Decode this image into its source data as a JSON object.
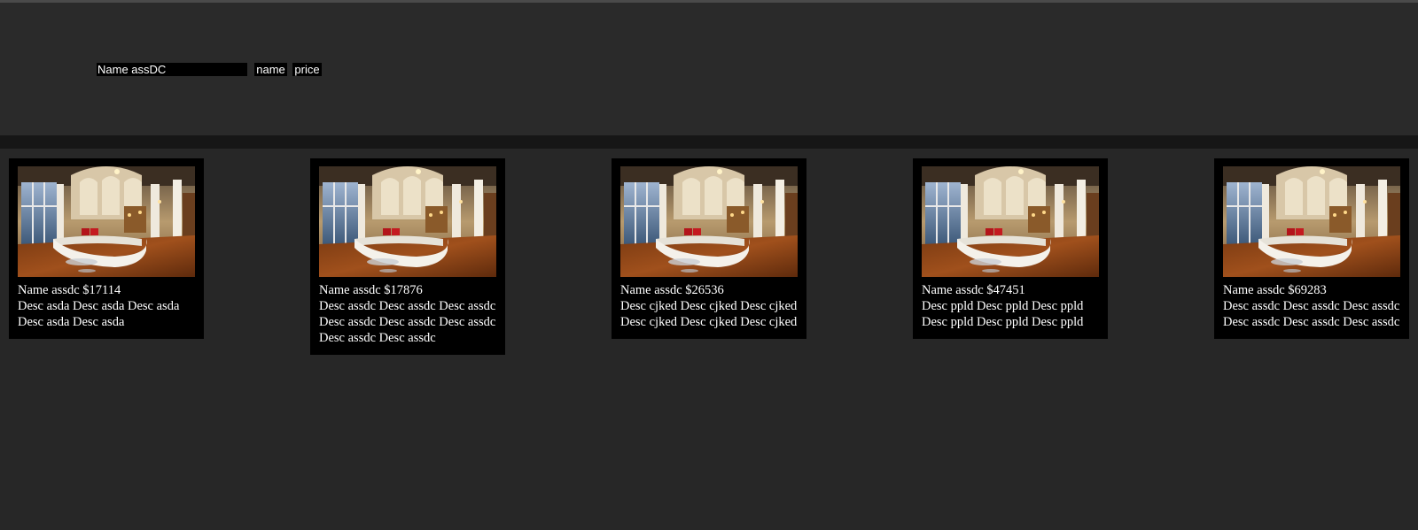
{
  "search": {
    "value": "Name assDC",
    "placeholder": ""
  },
  "sort": {
    "name_label": "name",
    "price_label": "price"
  },
  "products": [
    {
      "title": "Name assdc $17114",
      "desc": "Desc asda Desc asda Desc asda Desc asda Desc asda"
    },
    {
      "title": "Name assdc $17876",
      "desc": "Desc assdc Desc assdc Desc assdc Desc assdc Desc assdc Desc assdc Desc assdc Desc assdc"
    },
    {
      "title": "Name assdc $26536",
      "desc": "Desc cjked Desc cjked Desc cjked Desc cjked Desc cjked Desc cjked"
    },
    {
      "title": "Name assdc $47451",
      "desc": "Desc ppld Desc ppld Desc ppld Desc ppld Desc ppld Desc ppld"
    },
    {
      "title": "Name assdc $69283",
      "desc": "Desc assdc Desc assdc Desc assdc Desc assdc Desc assdc Desc assdc"
    }
  ],
  "colors": {
    "background": "#272727",
    "header": "#2a2a2a",
    "divider": "#161616",
    "card": "#000000",
    "text": "#ffffff"
  }
}
